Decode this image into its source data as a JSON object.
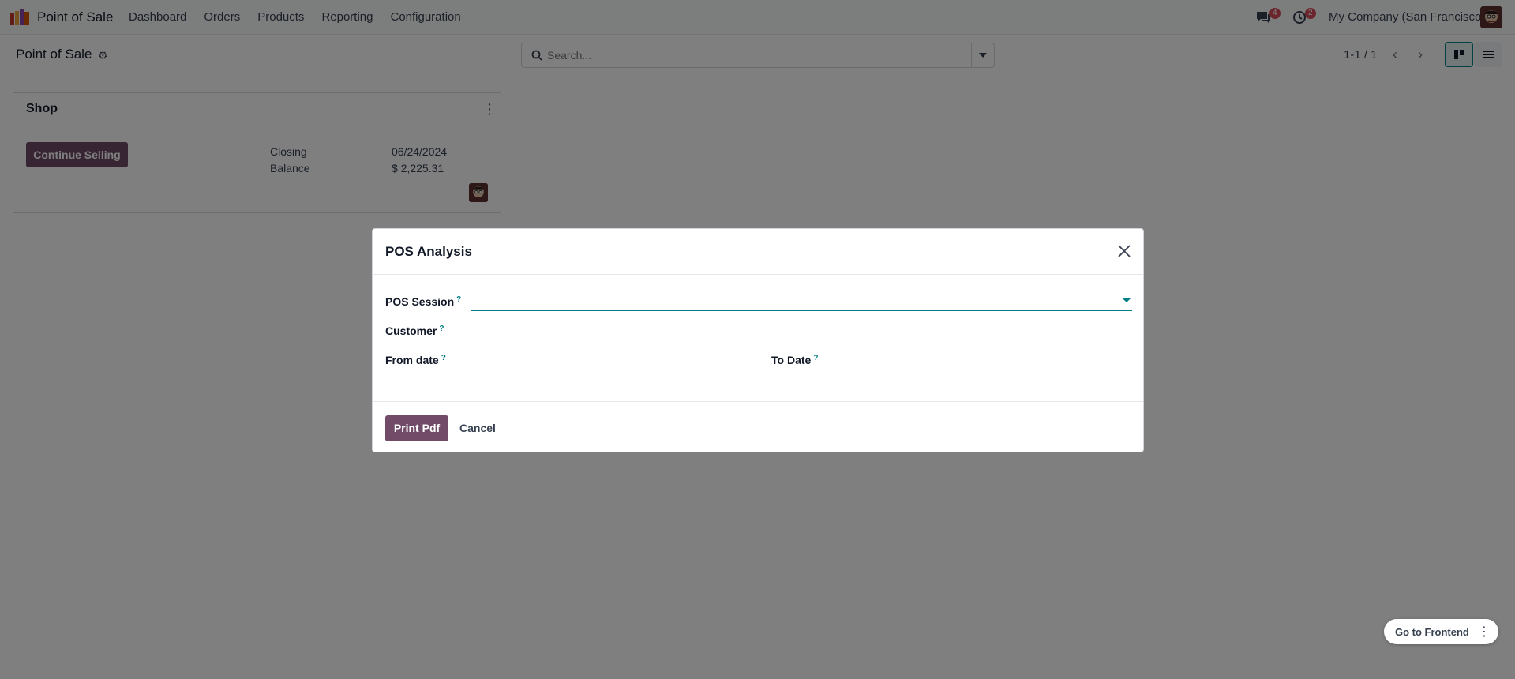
{
  "navbar": {
    "app_name": "Point of Sale",
    "menu": [
      "Dashboard",
      "Orders",
      "Products",
      "Reporting",
      "Configuration"
    ],
    "messages_badge": "4",
    "activities_badge": "2",
    "company": "My Company (San Francisco)"
  },
  "control_panel": {
    "title": "Point of Sale",
    "search_placeholder": "Search...",
    "pager": "1-1 / 1"
  },
  "card": {
    "title": "Shop",
    "button": "Continue Selling",
    "rows": [
      {
        "label": "Closing",
        "value": "06/24/2024"
      },
      {
        "label": "Balance",
        "value": "$ 2,225.31"
      }
    ]
  },
  "modal": {
    "title": "POS Analysis",
    "fields": {
      "pos_session": "POS Session",
      "customer": "Customer",
      "from_date": "From date",
      "to_date": "To Date"
    },
    "help_mark": "?",
    "print": "Print Pdf",
    "cancel": "Cancel"
  },
  "floating": {
    "go_to_frontend": "Go to Frontend"
  },
  "colors": {
    "brand": "#714b67",
    "accent": "#017e84",
    "badge": "#d44c59"
  }
}
